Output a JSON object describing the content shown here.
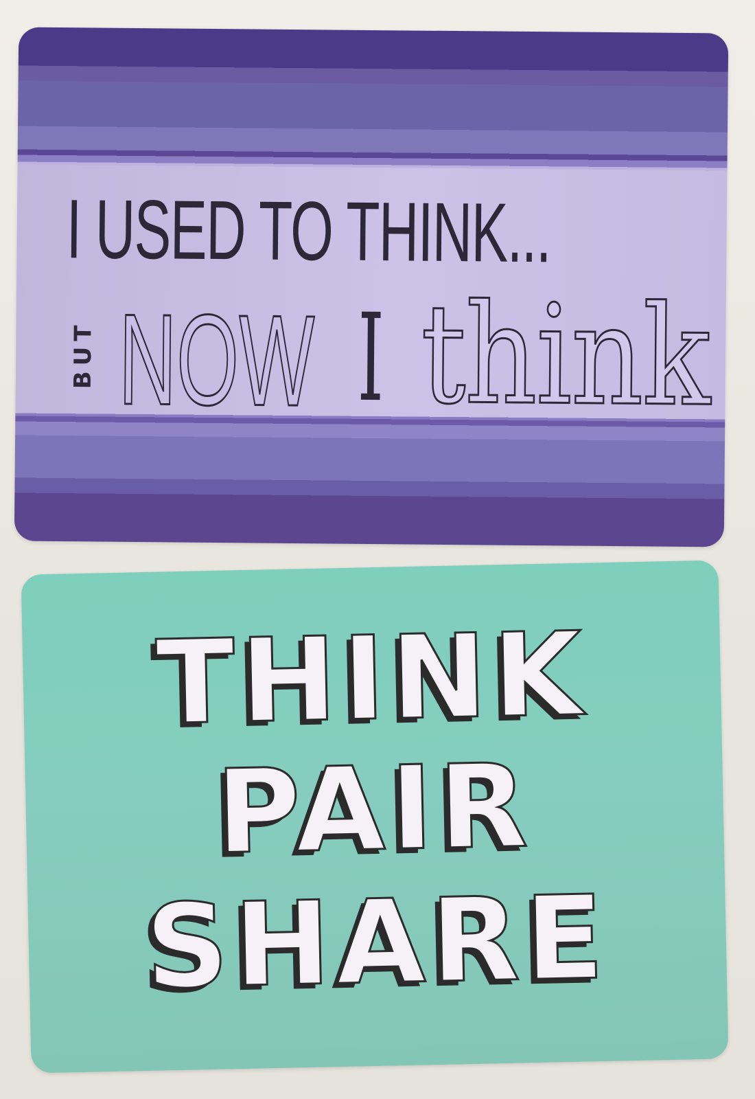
{
  "cards": [
    {
      "id": "used-to-think",
      "line1": "I USED TO THINK...",
      "but": "BUT",
      "now": "NOW",
      "i": "I",
      "think": "think",
      "colors": {
        "band": "#4a3a88",
        "panel": "#c9bee6",
        "ink": "#2c2838"
      }
    },
    {
      "id": "think-pair-share",
      "lines": [
        "THINK",
        "PAIR",
        "SHARE"
      ],
      "colors": {
        "background": "#86cdbf",
        "letters": "#f6f1f6",
        "outline": "#2b2b2b"
      }
    }
  ]
}
